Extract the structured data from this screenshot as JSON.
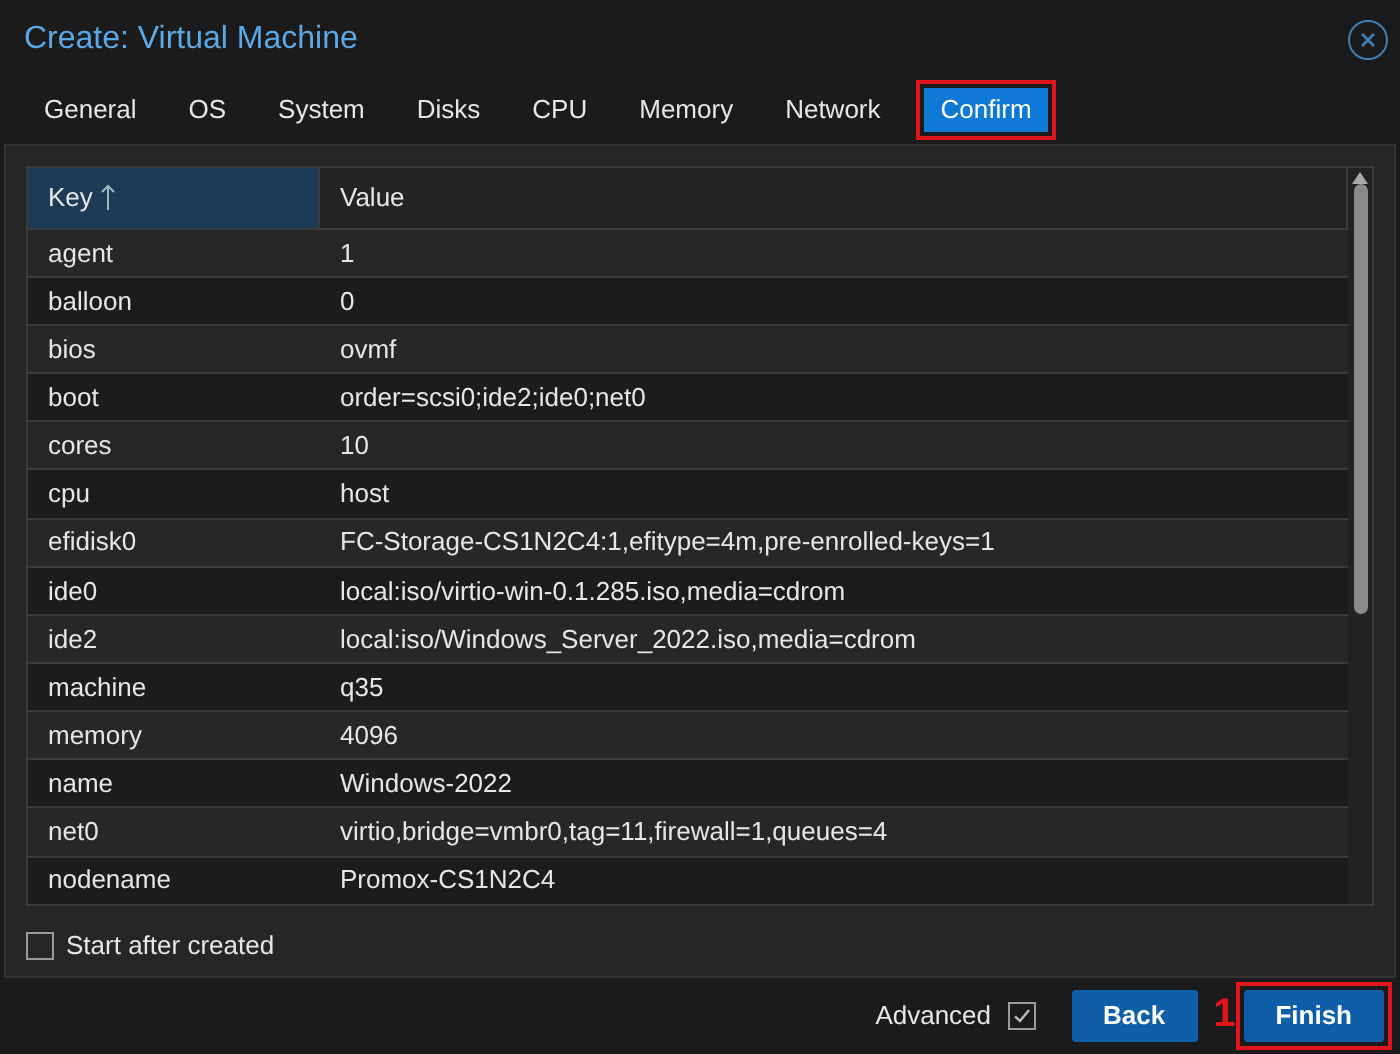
{
  "window": {
    "title": "Create: Virtual Machine"
  },
  "tabs": [
    {
      "label": "General",
      "selected": false,
      "highlighted": false
    },
    {
      "label": "OS",
      "selected": false,
      "highlighted": false
    },
    {
      "label": "System",
      "selected": false,
      "highlighted": false
    },
    {
      "label": "Disks",
      "selected": false,
      "highlighted": false
    },
    {
      "label": "CPU",
      "selected": false,
      "highlighted": false
    },
    {
      "label": "Memory",
      "selected": false,
      "highlighted": false
    },
    {
      "label": "Network",
      "selected": false,
      "highlighted": false
    },
    {
      "label": "Confirm",
      "selected": true,
      "highlighted": true
    }
  ],
  "table": {
    "columns": [
      {
        "label": "Key",
        "sorted": true
      },
      {
        "label": "Value",
        "sorted": false
      }
    ],
    "rows": [
      [
        "agent",
        "1"
      ],
      [
        "balloon",
        "0"
      ],
      [
        "bios",
        "ovmf"
      ],
      [
        "boot",
        "order=scsi0;ide2;ide0;net0"
      ],
      [
        "cores",
        "10"
      ],
      [
        "cpu",
        "host"
      ],
      [
        "efidisk0",
        "FC-Storage-CS1N2C4:1,efitype=4m,pre-enrolled-keys=1"
      ],
      [
        "ide0",
        "local:iso/virtio-win-0.1.285.iso,media=cdrom"
      ],
      [
        "ide2",
        "local:iso/Windows_Server_2022.iso,media=cdrom"
      ],
      [
        "machine",
        "q35"
      ],
      [
        "memory",
        "4096"
      ],
      [
        "name",
        "Windows-2022"
      ],
      [
        "net0",
        "virtio,bridge=vmbr0,tag=11,firewall=1,queues=4"
      ],
      [
        "nodename",
        "Promox-CS1N2C4"
      ]
    ]
  },
  "start_after_created": {
    "label": "Start after created",
    "checked": false
  },
  "footer": {
    "advanced": {
      "label": "Advanced",
      "checked": true
    },
    "buttons": [
      {
        "label": "Back",
        "highlighted": false
      },
      {
        "label": "Finish",
        "highlighted": true,
        "callout": "1"
      }
    ]
  }
}
